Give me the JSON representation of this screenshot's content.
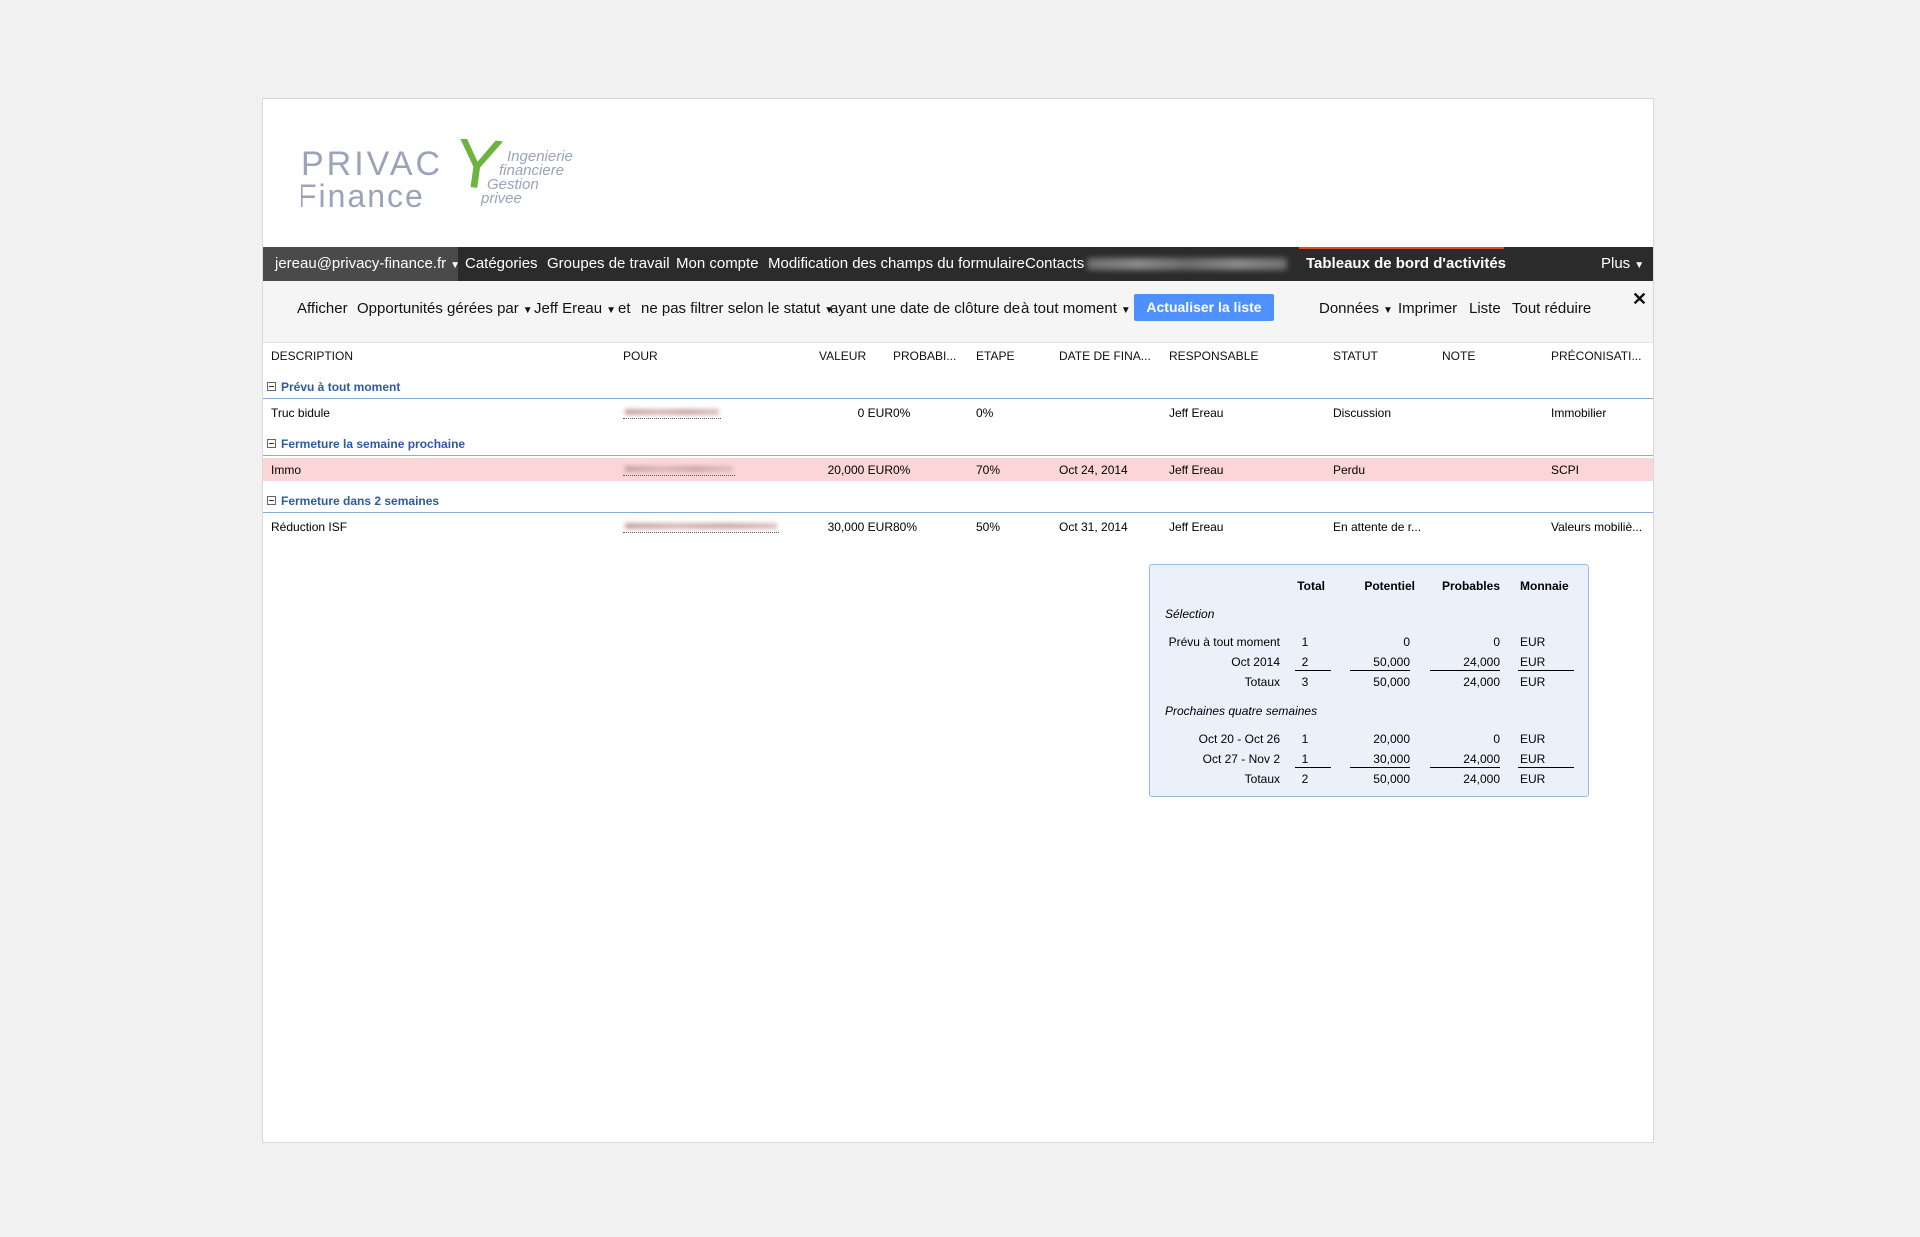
{
  "logo": {
    "word1": "PRIVAC",
    "word2": "Finance",
    "letter": "Y",
    "tagline": [
      "Ingenierie",
      "financiere",
      "Gestion",
      "privee"
    ]
  },
  "nav": {
    "user": "jereau@privacy-finance.fr",
    "items": [
      "Catégories",
      "Groupes de travail",
      "Mon compte",
      "Modification des champs du formulaire",
      "Contacts"
    ],
    "active": "Tableaux de bord d'activités",
    "more": "Plus"
  },
  "filters": {
    "show_label": "Afficher",
    "scope": "Opportunités gérées par",
    "owner": "Jeff Ereau",
    "and_label": "et",
    "status": "ne pas filtrer selon le statut",
    "date_label": "ayant une date de clôture de",
    "period": "à tout moment",
    "refresh": "Actualiser la liste",
    "data_menu": "Données",
    "print": "Imprimer",
    "list": "Liste",
    "collapse_all": "Tout réduire",
    "close": "✕"
  },
  "table": {
    "headers": [
      "DESCRIPTION",
      "POUR",
      "VALEUR",
      "PROBABI...",
      "ETAPE",
      "DATE DE FINA...",
      "RESPONSABLE",
      "STATUT",
      "NOTE",
      "PRÉCONISATI..."
    ],
    "groups": [
      {
        "label": "Prévu à tout moment",
        "rows": [
          {
            "description": "Truc bidule",
            "valeur": "0 EUR",
            "probabilite": "0%",
            "etape": "0%",
            "date": "",
            "responsable": "Jeff Ereau",
            "statut": "Discussion",
            "note": "",
            "preconisation": "Immobilier"
          }
        ]
      },
      {
        "label": "Fermeture la semaine prochaine",
        "rows": [
          {
            "description": "Immo",
            "valeur": "20,000 EUR",
            "probabilite": "0%",
            "etape": "70%",
            "date": "Oct 24, 2014",
            "responsable": "Jeff Ereau",
            "statut": "Perdu",
            "note": "",
            "preconisation": "SCPI"
          }
        ]
      },
      {
        "label": "Fermeture dans 2 semaines",
        "rows": [
          {
            "description": "Réduction ISF",
            "valeur": "30,000 EUR",
            "probabilite": "80%",
            "etape": "50%",
            "date": "Oct 31, 2014",
            "responsable": "Jeff Ereau",
            "statut": "En attente de r...",
            "note": "",
            "preconisation": "Valeurs mobiliè..."
          }
        ]
      }
    ]
  },
  "summary": {
    "headers": [
      "Total",
      "Potentiel",
      "Probables",
      "Monnaie"
    ],
    "sections": [
      {
        "title": "Sélection",
        "rows": [
          {
            "label": "Prévu à tout moment",
            "total": "1",
            "potentiel": "0",
            "probables": "0",
            "monnaie": "EUR"
          },
          {
            "label": "Oct 2014",
            "total": "2",
            "potentiel": "50,000",
            "probables": "24,000",
            "monnaie": "EUR"
          },
          {
            "label": "Totaux",
            "total": "3",
            "potentiel": "50,000",
            "probables": "24,000",
            "monnaie": "EUR"
          }
        ]
      },
      {
        "title": "Prochaines quatre semaines",
        "rows": [
          {
            "label": "Oct 20 - Oct 26",
            "total": "1",
            "potentiel": "20,000",
            "probables": "0",
            "monnaie": "EUR"
          },
          {
            "label": "Oct 27 - Nov 2",
            "total": "1",
            "potentiel": "30,000",
            "probables": "24,000",
            "monnaie": "EUR"
          },
          {
            "label": "Totaux",
            "total": "2",
            "potentiel": "50,000",
            "probables": "24,000",
            "monnaie": "EUR"
          }
        ]
      }
    ]
  },
  "colors": {
    "navbar": "#2b2b2b",
    "accent_button": "#4d90fe",
    "group_label": "#2f5aa3",
    "lost_row": "#fcd6d6",
    "logo_y": "#6db33f",
    "logo_text": "#9aa3b8"
  }
}
